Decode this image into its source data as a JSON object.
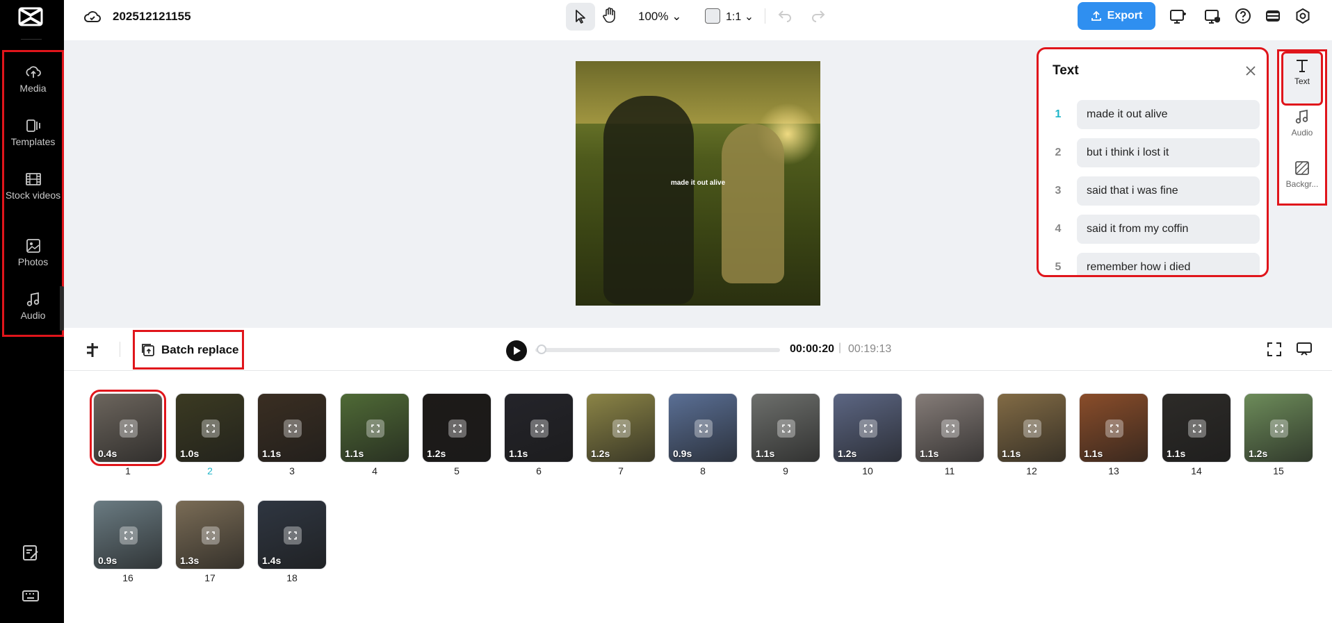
{
  "project": {
    "title": "202512121155"
  },
  "toolbar": {
    "zoom": "100%",
    "ratio": "1:1",
    "export_label": "Export"
  },
  "left_nav": {
    "items": [
      {
        "label": "Media",
        "icon": "cloud-upload-icon"
      },
      {
        "label": "Templates",
        "icon": "templates-icon"
      },
      {
        "label": "Stock videos",
        "icon": "film-icon"
      },
      {
        "label": "Photos",
        "icon": "image-icon"
      },
      {
        "label": "Audio",
        "icon": "music-note-icon"
      }
    ]
  },
  "preview": {
    "caption": "made it out alive"
  },
  "text_panel": {
    "title": "Text",
    "rows": [
      {
        "num": "1",
        "text": "made it out alive"
      },
      {
        "num": "2",
        "text": "but i think i lost it"
      },
      {
        "num": "3",
        "text": "said that i was fine"
      },
      {
        "num": "4",
        "text": "said it from my coffin"
      },
      {
        "num": "5",
        "text": "remember how i died"
      }
    ]
  },
  "right_rail": {
    "items": [
      {
        "label": "Text",
        "icon": "text-icon"
      },
      {
        "label": "Audio",
        "icon": "music-note-icon"
      },
      {
        "label": "Backgr...",
        "icon": "background-icon"
      }
    ]
  },
  "player": {
    "batch_replace_label": "Batch replace",
    "current_time": "00:00:20",
    "separator": "|",
    "total_time": "00:19:13",
    "progress": 0.01
  },
  "clips": [
    {
      "num": "1",
      "dur": "0.4s",
      "color": "#6c655d"
    },
    {
      "num": "2",
      "dur": "1.0s",
      "color": "#3b3a22"
    },
    {
      "num": "3",
      "dur": "1.1s",
      "color": "#3a2e22"
    },
    {
      "num": "4",
      "dur": "1.1s",
      "color": "#4f6a36"
    },
    {
      "num": "5",
      "dur": "1.2s",
      "color": "#1d1a18"
    },
    {
      "num": "6",
      "dur": "1.1s",
      "color": "#24242a"
    },
    {
      "num": "7",
      "dur": "1.2s",
      "color": "#8b8446"
    },
    {
      "num": "8",
      "dur": "0.9s",
      "color": "#5a6f95"
    },
    {
      "num": "9",
      "dur": "1.1s",
      "color": "#6d6f6c"
    },
    {
      "num": "10",
      "dur": "1.2s",
      "color": "#5c6683"
    },
    {
      "num": "11",
      "dur": "1.1s",
      "color": "#857c78"
    },
    {
      "num": "12",
      "dur": "1.1s",
      "color": "#826b45"
    },
    {
      "num": "13",
      "dur": "1.1s",
      "color": "#8a4d2a"
    },
    {
      "num": "14",
      "dur": "1.1s",
      "color": "#2d2b28"
    },
    {
      "num": "15",
      "dur": "1.2s",
      "color": "#6d8c5a"
    },
    {
      "num": "16",
      "dur": "0.9s",
      "color": "#6a7b82"
    },
    {
      "num": "17",
      "dur": "1.3s",
      "color": "#7a6c56"
    },
    {
      "num": "18",
      "dur": "1.4s",
      "color": "#2f3641"
    }
  ],
  "colors": {
    "accent": "#2f8ff0",
    "active_number": "#1fb5c9",
    "highlight": "#e0151b"
  }
}
